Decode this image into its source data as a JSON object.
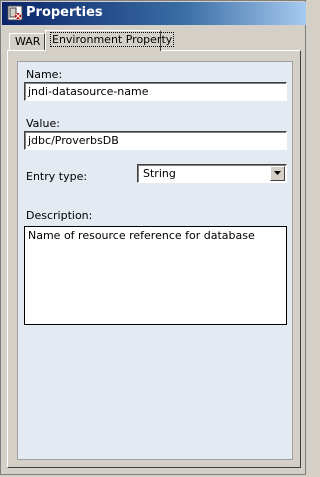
{
  "window": {
    "title": "Properties",
    "icon": "properties-app-icon"
  },
  "tabs": [
    {
      "label": "WAR",
      "active": false
    },
    {
      "label": "Environment Property",
      "active": true
    }
  ],
  "form": {
    "name_label": "Name:",
    "name_value": "jndi-datasource-name",
    "value_label": "Value:",
    "value_value": "jdbc/ProverbsDB",
    "entry_type_label": "Entry type:",
    "entry_type_value": "String",
    "description_label": "Description:",
    "description_value": "Name of resource reference for database"
  },
  "colors": {
    "title_start": "#0a246a",
    "title_end": "#a6caf0",
    "panel_bg": "#e4eaf2",
    "window_bg": "#d4d0c8"
  }
}
